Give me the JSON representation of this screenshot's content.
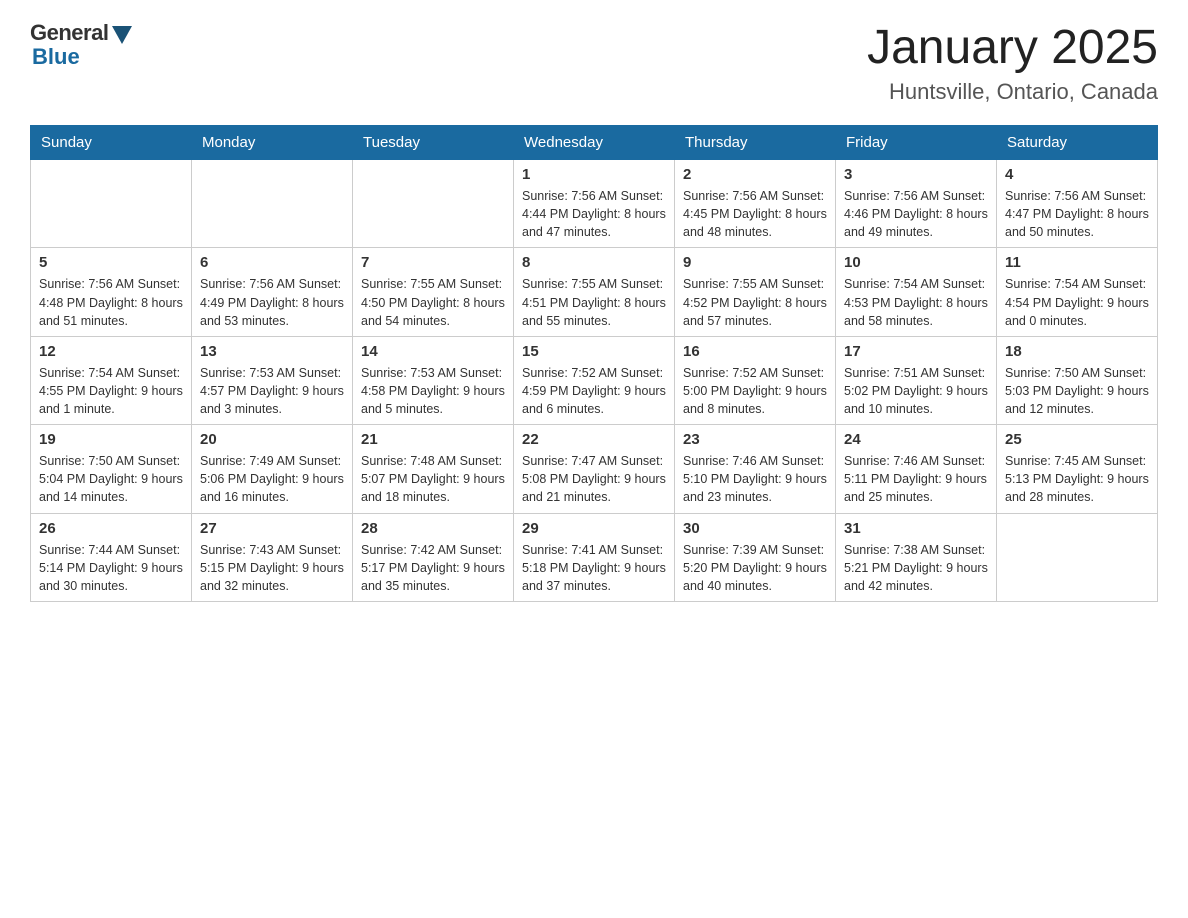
{
  "logo": {
    "general": "General",
    "blue": "Blue"
  },
  "title": "January 2025",
  "location": "Huntsville, Ontario, Canada",
  "weekdays": [
    "Sunday",
    "Monday",
    "Tuesday",
    "Wednesday",
    "Thursday",
    "Friday",
    "Saturday"
  ],
  "weeks": [
    [
      {
        "day": "",
        "info": ""
      },
      {
        "day": "",
        "info": ""
      },
      {
        "day": "",
        "info": ""
      },
      {
        "day": "1",
        "info": "Sunrise: 7:56 AM\nSunset: 4:44 PM\nDaylight: 8 hours\nand 47 minutes."
      },
      {
        "day": "2",
        "info": "Sunrise: 7:56 AM\nSunset: 4:45 PM\nDaylight: 8 hours\nand 48 minutes."
      },
      {
        "day": "3",
        "info": "Sunrise: 7:56 AM\nSunset: 4:46 PM\nDaylight: 8 hours\nand 49 minutes."
      },
      {
        "day": "4",
        "info": "Sunrise: 7:56 AM\nSunset: 4:47 PM\nDaylight: 8 hours\nand 50 minutes."
      }
    ],
    [
      {
        "day": "5",
        "info": "Sunrise: 7:56 AM\nSunset: 4:48 PM\nDaylight: 8 hours\nand 51 minutes."
      },
      {
        "day": "6",
        "info": "Sunrise: 7:56 AM\nSunset: 4:49 PM\nDaylight: 8 hours\nand 53 minutes."
      },
      {
        "day": "7",
        "info": "Sunrise: 7:55 AM\nSunset: 4:50 PM\nDaylight: 8 hours\nand 54 minutes."
      },
      {
        "day": "8",
        "info": "Sunrise: 7:55 AM\nSunset: 4:51 PM\nDaylight: 8 hours\nand 55 minutes."
      },
      {
        "day": "9",
        "info": "Sunrise: 7:55 AM\nSunset: 4:52 PM\nDaylight: 8 hours\nand 57 minutes."
      },
      {
        "day": "10",
        "info": "Sunrise: 7:54 AM\nSunset: 4:53 PM\nDaylight: 8 hours\nand 58 minutes."
      },
      {
        "day": "11",
        "info": "Sunrise: 7:54 AM\nSunset: 4:54 PM\nDaylight: 9 hours\nand 0 minutes."
      }
    ],
    [
      {
        "day": "12",
        "info": "Sunrise: 7:54 AM\nSunset: 4:55 PM\nDaylight: 9 hours\nand 1 minute."
      },
      {
        "day": "13",
        "info": "Sunrise: 7:53 AM\nSunset: 4:57 PM\nDaylight: 9 hours\nand 3 minutes."
      },
      {
        "day": "14",
        "info": "Sunrise: 7:53 AM\nSunset: 4:58 PM\nDaylight: 9 hours\nand 5 minutes."
      },
      {
        "day": "15",
        "info": "Sunrise: 7:52 AM\nSunset: 4:59 PM\nDaylight: 9 hours\nand 6 minutes."
      },
      {
        "day": "16",
        "info": "Sunrise: 7:52 AM\nSunset: 5:00 PM\nDaylight: 9 hours\nand 8 minutes."
      },
      {
        "day": "17",
        "info": "Sunrise: 7:51 AM\nSunset: 5:02 PM\nDaylight: 9 hours\nand 10 minutes."
      },
      {
        "day": "18",
        "info": "Sunrise: 7:50 AM\nSunset: 5:03 PM\nDaylight: 9 hours\nand 12 minutes."
      }
    ],
    [
      {
        "day": "19",
        "info": "Sunrise: 7:50 AM\nSunset: 5:04 PM\nDaylight: 9 hours\nand 14 minutes."
      },
      {
        "day": "20",
        "info": "Sunrise: 7:49 AM\nSunset: 5:06 PM\nDaylight: 9 hours\nand 16 minutes."
      },
      {
        "day": "21",
        "info": "Sunrise: 7:48 AM\nSunset: 5:07 PM\nDaylight: 9 hours\nand 18 minutes."
      },
      {
        "day": "22",
        "info": "Sunrise: 7:47 AM\nSunset: 5:08 PM\nDaylight: 9 hours\nand 21 minutes."
      },
      {
        "day": "23",
        "info": "Sunrise: 7:46 AM\nSunset: 5:10 PM\nDaylight: 9 hours\nand 23 minutes."
      },
      {
        "day": "24",
        "info": "Sunrise: 7:46 AM\nSunset: 5:11 PM\nDaylight: 9 hours\nand 25 minutes."
      },
      {
        "day": "25",
        "info": "Sunrise: 7:45 AM\nSunset: 5:13 PM\nDaylight: 9 hours\nand 28 minutes."
      }
    ],
    [
      {
        "day": "26",
        "info": "Sunrise: 7:44 AM\nSunset: 5:14 PM\nDaylight: 9 hours\nand 30 minutes."
      },
      {
        "day": "27",
        "info": "Sunrise: 7:43 AM\nSunset: 5:15 PM\nDaylight: 9 hours\nand 32 minutes."
      },
      {
        "day": "28",
        "info": "Sunrise: 7:42 AM\nSunset: 5:17 PM\nDaylight: 9 hours\nand 35 minutes."
      },
      {
        "day": "29",
        "info": "Sunrise: 7:41 AM\nSunset: 5:18 PM\nDaylight: 9 hours\nand 37 minutes."
      },
      {
        "day": "30",
        "info": "Sunrise: 7:39 AM\nSunset: 5:20 PM\nDaylight: 9 hours\nand 40 minutes."
      },
      {
        "day": "31",
        "info": "Sunrise: 7:38 AM\nSunset: 5:21 PM\nDaylight: 9 hours\nand 42 minutes."
      },
      {
        "day": "",
        "info": ""
      }
    ]
  ]
}
